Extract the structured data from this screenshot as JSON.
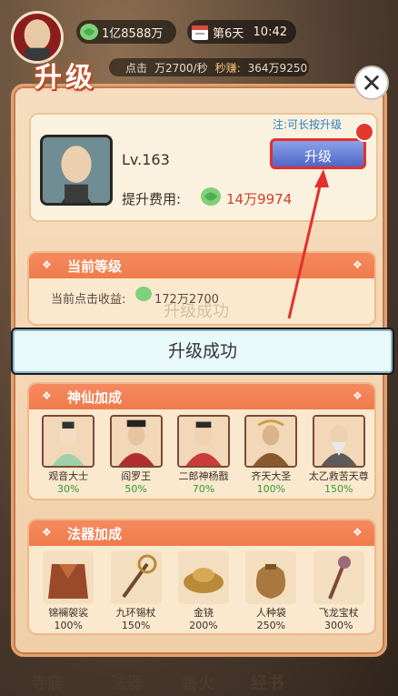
{
  "hud": {
    "money": "1亿8588万",
    "day": "第6天",
    "time": "10:42",
    "rate_label": "点击",
    "rate_value": "万2700/秒",
    "earn_label": "秒赚:",
    "earn_value": "364万9250"
  },
  "panel": {
    "title": "升级",
    "close_label": "✕",
    "hint": "注:可长按升级",
    "level": "Lv.163",
    "cost_label": "提升费用:",
    "cost_value": "14万9974",
    "upgrade_label": "升级"
  },
  "current": {
    "title": "当前等级",
    "click_income_label": "当前点击收益:",
    "click_income_value": "172万2700",
    "ghost": "升级成功"
  },
  "success": {
    "label": "升级成功"
  },
  "gods": {
    "title": "神仙加成",
    "items": [
      {
        "name": "观音大士",
        "pct": "30%"
      },
      {
        "name": "阎罗王",
        "pct": "50%"
      },
      {
        "name": "二郎神杨戬",
        "pct": "70%"
      },
      {
        "name": "齐天大圣",
        "pct": "100%"
      },
      {
        "name": "太乙救苦天尊",
        "pct": "150%"
      }
    ]
  },
  "artifacts": {
    "title": "法器加成",
    "items": [
      {
        "name": "锦襕袈裟",
        "pct": "100%"
      },
      {
        "name": "九环锡杖",
        "pct": "150%"
      },
      {
        "name": "金铙",
        "pct": "200%"
      },
      {
        "name": "人种袋",
        "pct": "250%"
      },
      {
        "name": "飞龙宝杖",
        "pct": "300%"
      }
    ]
  },
  "tabs": [
    "寺庙",
    "法器",
    "香火",
    "经书"
  ],
  "colors": {
    "accent": "#f07b4a",
    "button": "#4f67c6",
    "highlight": "#e3302c",
    "cost": "#d2402a",
    "pct_green": "#2e9a2e"
  },
  "icons": [
    "cabbage-coin-icon",
    "calendar-icon",
    "close-icon",
    "red-arrow"
  ]
}
